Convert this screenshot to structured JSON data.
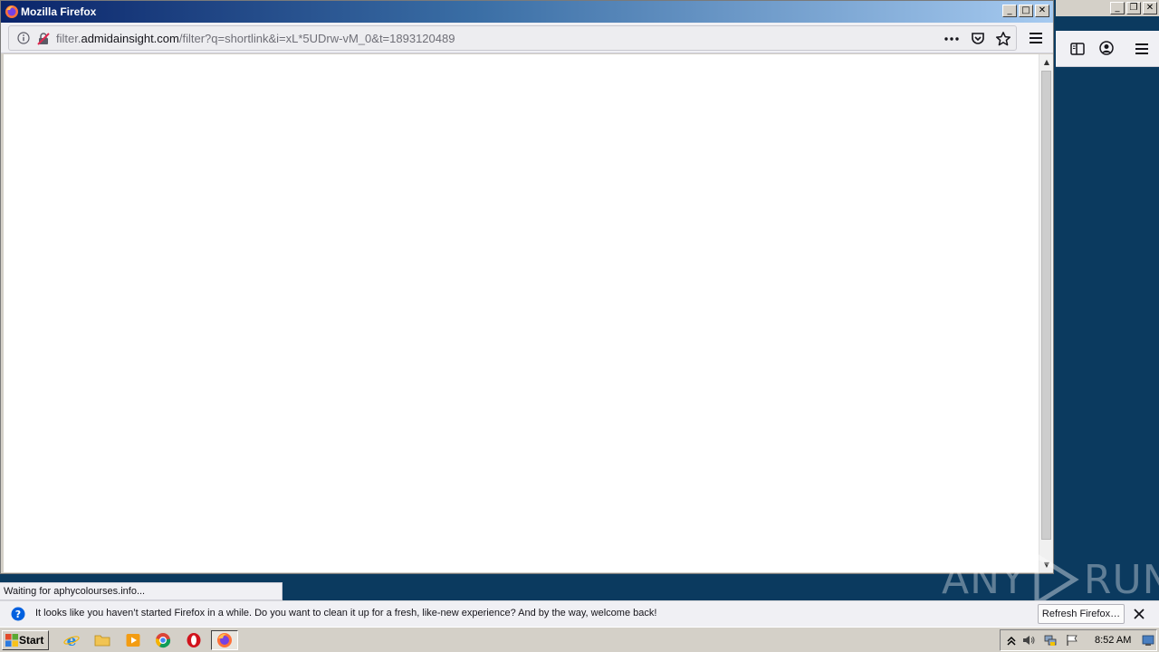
{
  "window": {
    "title": "Mozilla Firefox"
  },
  "urlbar": {
    "url_prefix": "filter.",
    "url_domain": "admidainsight.com",
    "url_path": "/filter?q=shortlink&i=xL*5UDrw-vM_0&t=1893120489"
  },
  "status": {
    "text": "Waiting for aphycolourses.info..."
  },
  "notification": {
    "message": "It looks like you haven’t started Firefox in a while. Do you want to clean it up for a fresh, like-new experience? And by the way, welcome back!",
    "refresh_label": "Refresh Firefox…"
  },
  "watermark": {
    "left": "ANY",
    "right": "RUN"
  },
  "taskbar": {
    "start_label": "Start",
    "clock": "8:52 AM",
    "apps": [
      "internet-explorer-icon",
      "file-explorer-icon",
      "media-player-icon",
      "chrome-icon",
      "opera-icon",
      "firefox-icon"
    ]
  },
  "colors": {
    "desktop": "#0b3a5f",
    "title_gradient_start": "#0a246a",
    "title_gradient_end": "#a6caf0"
  }
}
